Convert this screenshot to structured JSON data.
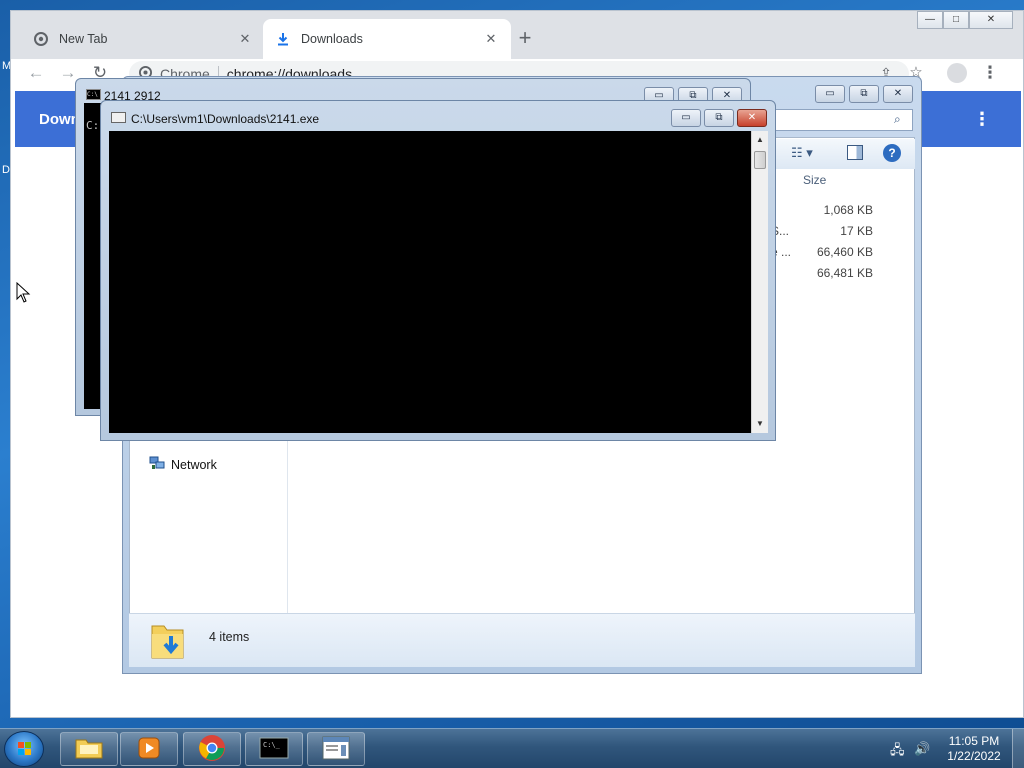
{
  "desktop": {
    "edge_letter_1": "M",
    "edge_letter_2": "D"
  },
  "chrome": {
    "tabs": [
      {
        "label": "New Tab",
        "icon": "chrome-icon",
        "active": false
      },
      {
        "label": "Downloads",
        "icon": "download-icon",
        "active": true
      }
    ],
    "new_tab": "+",
    "site_chip": "Chrome",
    "url": "chrome://downloads",
    "appbar_title": "Down",
    "window_controls": {
      "minimize": "▭",
      "maximize": "⧉",
      "close": "✕"
    }
  },
  "explorer": {
    "column_header": "Size",
    "rows": [
      {
        "truncated": "",
        "size": "1,068 KB"
      },
      {
        "truncated": "S...",
        "size": "17 KB"
      },
      {
        "truncated": "e ...",
        "size": "66,460 KB"
      },
      {
        "truncated": "",
        "size": "66,481 KB"
      }
    ],
    "nav_network": "Network",
    "status_count": "4 items"
  },
  "cmd_back": {
    "title": "2141  2912",
    "console_prompt": "C:"
  },
  "cmd_front": {
    "title": "C:\\Users\\vm1\\Downloads\\2141.exe"
  },
  "taskbar": {
    "clock_time": "11:05 PM",
    "clock_date": "1/22/2022",
    "items": [
      "explorer-icon",
      "media-player-icon",
      "chrome-icon",
      "command-prompt-icon",
      "window-app-icon"
    ]
  },
  "colors": {
    "chrome_accent": "#3c6fd6",
    "console_bg": "#000000",
    "taskbar": "#30567c"
  }
}
